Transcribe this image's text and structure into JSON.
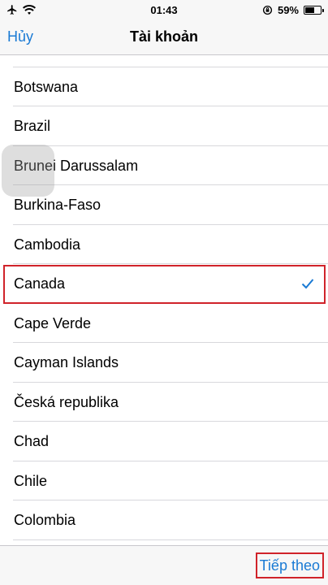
{
  "status_bar": {
    "time": "01:43",
    "battery_percent": "59%",
    "battery_level": 0.59,
    "icons": [
      "airplane-icon",
      "wifi-icon",
      "rotation-lock-icon",
      "battery-icon"
    ]
  },
  "nav": {
    "cancel_label": "Hủy",
    "title": "Tài khoản"
  },
  "countries": [
    "Botswana",
    "Brazil",
    "Brunei Darussalam",
    "Burkina-Faso",
    "Cambodia",
    "Canada",
    "Cape Verde",
    "Cayman Islands",
    "Česká republika",
    "Chad",
    "Chile",
    "Colombia"
  ],
  "selected_country": "Canada",
  "toolbar": {
    "next_label": "Tiếp theo"
  },
  "colors": {
    "accent": "#1a7ad4",
    "highlight": "#d0232a"
  }
}
